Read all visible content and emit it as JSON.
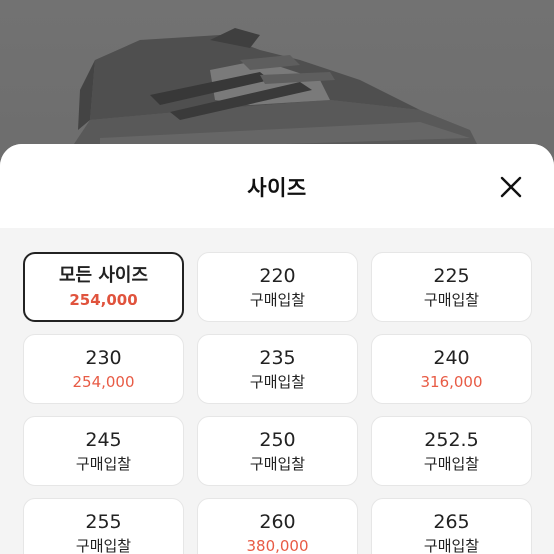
{
  "sheet": {
    "title": "사이즈",
    "close_icon": "close-icon"
  },
  "sizes": [
    {
      "label": "모든 사이즈",
      "price": "254,000",
      "has_price": true,
      "selected": true
    },
    {
      "label": "220",
      "price": "구매입찰",
      "has_price": false,
      "selected": false
    },
    {
      "label": "225",
      "price": "구매입찰",
      "has_price": false,
      "selected": false
    },
    {
      "label": "230",
      "price": "254,000",
      "has_price": true,
      "selected": false
    },
    {
      "label": "235",
      "price": "구매입찰",
      "has_price": false,
      "selected": false
    },
    {
      "label": "240",
      "price": "316,000",
      "has_price": true,
      "selected": false
    },
    {
      "label": "245",
      "price": "구매입찰",
      "has_price": false,
      "selected": false
    },
    {
      "label": "250",
      "price": "구매입찰",
      "has_price": false,
      "selected": false
    },
    {
      "label": "252.5",
      "price": "구매입찰",
      "has_price": false,
      "selected": false
    },
    {
      "label": "255",
      "price": "구매입찰",
      "has_price": false,
      "selected": false
    },
    {
      "label": "260",
      "price": "380,000",
      "has_price": true,
      "selected": false
    },
    {
      "label": "265",
      "price": "구매입찰",
      "has_price": false,
      "selected": false
    }
  ],
  "colors": {
    "price_accent": "#e85b45",
    "selected_border": "#222222",
    "overlay": "#6b6b6b"
  }
}
